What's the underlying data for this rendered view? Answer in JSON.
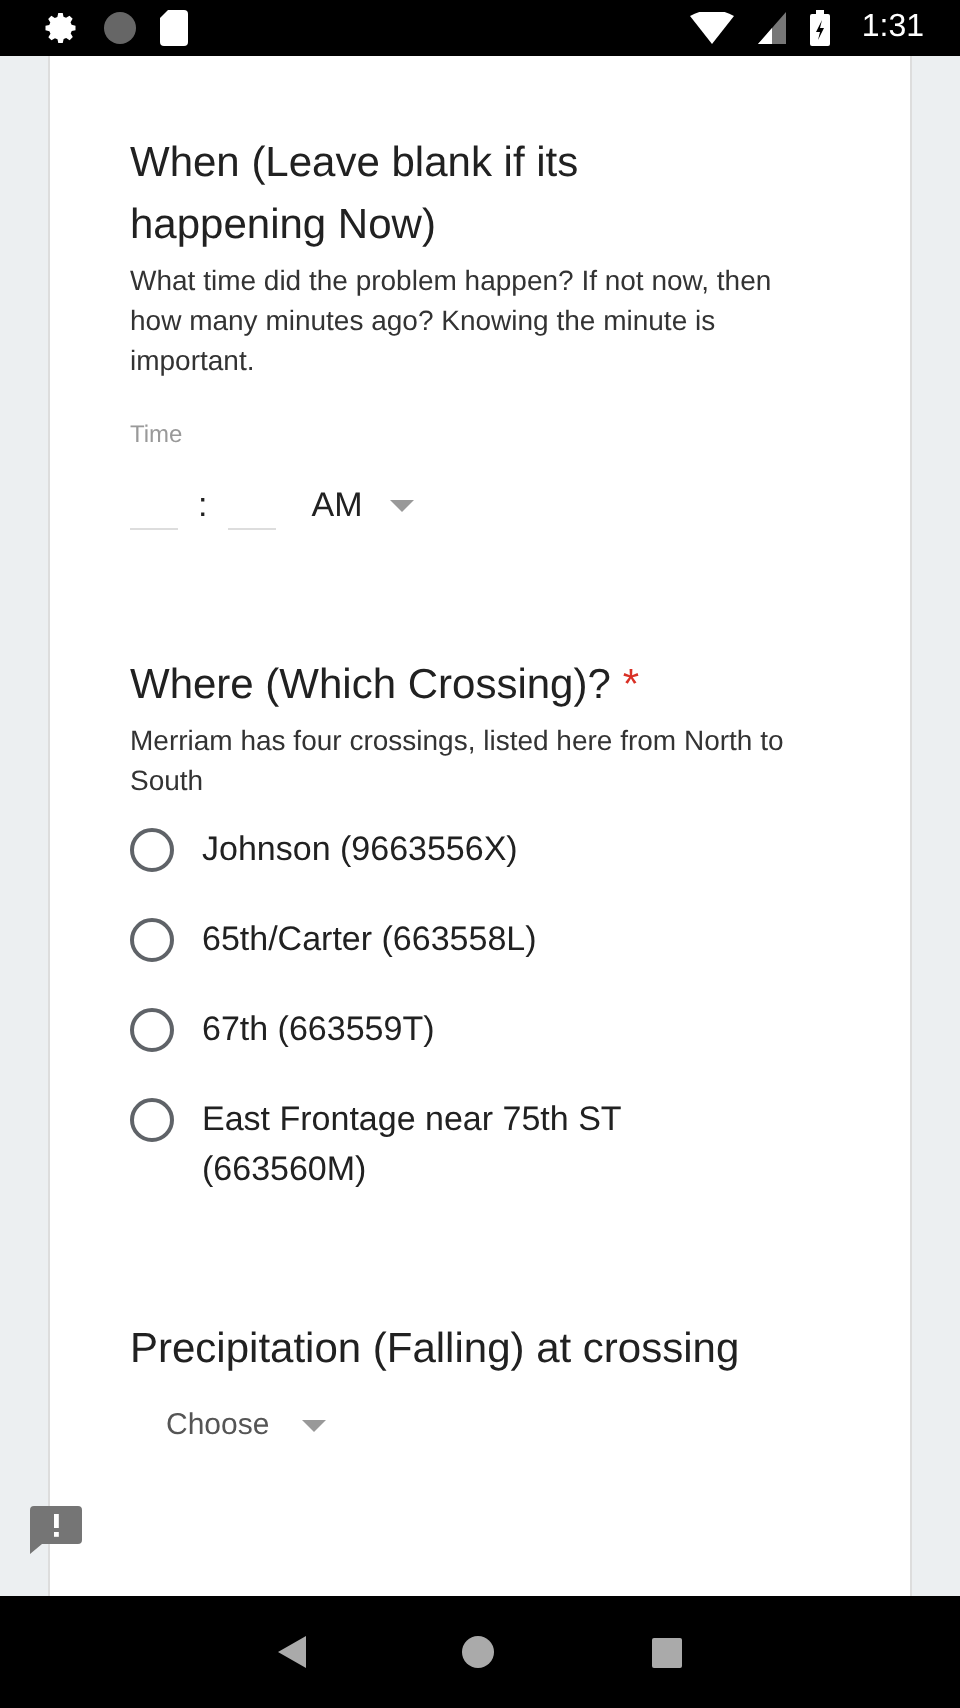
{
  "status_bar": {
    "time": "1:31"
  },
  "questions": [
    {
      "kind": "time",
      "title": "When (Leave blank if its happening Now)",
      "description": "What time did the problem happen? If not now, then how many minutes ago? Knowing the minute is important.",
      "field_label": "Time",
      "separator": ":",
      "period": "AM"
    },
    {
      "kind": "radio",
      "title": "Where (Which Crossing)?",
      "required_mark": "*",
      "description": "Merriam has four crossings, listed here from North to South",
      "options": [
        {
          "label": "Johnson (9663556X)",
          "selected": false
        },
        {
          "label": "65th/Carter (663558L)",
          "selected": false
        },
        {
          "label": "67th (663559T)",
          "selected": false
        },
        {
          "label": "East Frontage near 75th ST (663560M)",
          "selected": false
        }
      ]
    },
    {
      "kind": "dropdown",
      "title": "Precipitation (Falling) at crossing",
      "placeholder": "Choose"
    }
  ]
}
